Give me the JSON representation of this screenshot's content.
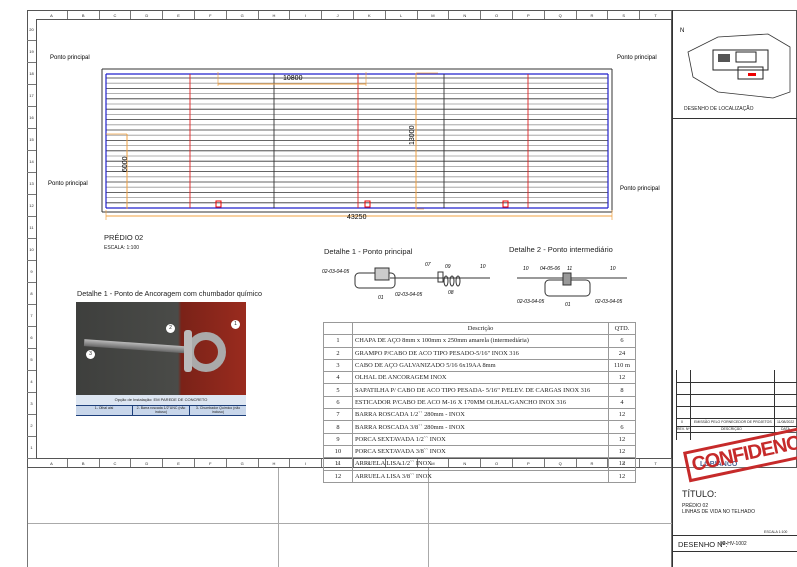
{
  "rulers": {
    "letters": [
      "A",
      "B",
      "C",
      "D",
      "E",
      "F",
      "G",
      "H",
      "I",
      "J",
      "K",
      "L",
      "M",
      "N",
      "O",
      "P",
      "Q",
      "R",
      "S",
      "T"
    ],
    "numbers": [
      "20",
      "19",
      "18",
      "17",
      "16",
      "15",
      "14",
      "13",
      "12",
      "11",
      "10",
      "9",
      "8",
      "7",
      "6",
      "5",
      "4",
      "3",
      "2",
      "1"
    ]
  },
  "plan": {
    "labels": {
      "tl": "Ponto principal",
      "tr": "Ponto principal",
      "bl": "Ponto principal",
      "br": "Ponto principal"
    },
    "dims": {
      "top": "10800",
      "vertical": "13000",
      "left": "6000",
      "total": "43250"
    },
    "building": "PRÉDIO  02",
    "scale": "ESCALA: 1:100"
  },
  "detail1": {
    "title": "Detalhe 1 - Ponto principal",
    "callouts": [
      "02-03-04-05",
      "07",
      "09",
      "10",
      "01",
      "02-03-04-05",
      "08"
    ]
  },
  "detail2": {
    "title": "Detalhe 2 - Ponto intermediário",
    "callouts": [
      "10",
      "04-05-06",
      "11",
      "10",
      "02-03-04-05",
      "01",
      "02-03-04-05"
    ]
  },
  "anchor": {
    "title": "Detalhe 1 - Ponto de Ancoragem com chumbador químico",
    "markers": [
      "1",
      "2",
      "3"
    ],
    "install": "Opção de Instalação: EM PAREDE DE CONCRETO",
    "parts": [
      "1- Olhal aisi",
      "2- Barra roscada 1/2\"UNC (não incluso)",
      "3- Chumbador Químico (não incluso)"
    ]
  },
  "bom": {
    "headers": [
      "",
      "Descrição",
      "QTD."
    ],
    "rows": [
      [
        "1",
        "CHAPA DE AÇO 8mm x 100mm x 250mm amarela (intermediária)",
        "6"
      ],
      [
        "2",
        "GRAMPO P/CABO DE ACO TIPO PESADO-5/16\" INOX 316",
        "24"
      ],
      [
        "3",
        "CABO DE AÇO GALVANIZADO 5/16 6x19AA 8mm",
        "110 m"
      ],
      [
        "4",
        "OLHAL DE ANCORAGEM INOX",
        "12"
      ],
      [
        "5",
        "SAPATILHA P/ CABO DE ACO TIPO PESADA- 5/16\" P/ELEV. DE CARGAS INOX 316",
        "8"
      ],
      [
        "6",
        "ESTICADOR P/CABO DE ACO M-16 X 170MM OLHAL/GANCHO INOX 316",
        "4"
      ],
      [
        "7",
        "BARRA ROSCADA 1/2`` 280mm - INOX",
        "12"
      ],
      [
        "8",
        "BARRA ROSCADA 3/8`` 280mm - INOX",
        "6"
      ],
      [
        "9",
        "PORCA SEXTAVADA 1/2`` INOX",
        "12"
      ],
      [
        "10",
        "PORCA SEXTAVADA 3/8`` INOX",
        "12"
      ],
      [
        "11",
        "ARRUELA LISA 1/2`` INOX",
        "12"
      ],
      [
        "12",
        "ARRUELA LISA 3/8`` INOX",
        "12"
      ]
    ]
  },
  "titleblock": {
    "location": "DESENHO DE LOCALIZAÇÃO",
    "rev": {
      "num": "0",
      "desc": "EMISSÃO PELO FORNECEDOR DE PROJETOS",
      "date": "11/08/2022"
    },
    "rev_headers": [
      "REV. Nº",
      "DESCRIÇÃO",
      "DATA"
    ],
    "company": "LOBIANCO",
    "stamp": "CONFIDENCIAL",
    "titulo": "TÍTULO:",
    "line1": "PRÉDIO 02",
    "line2": "LINHAS DE VIDA NO TELHADO",
    "escala": "ESCALA  1:100",
    "desenho_label": "DESENHO Nº:",
    "desenho": "02-HV-1002"
  }
}
